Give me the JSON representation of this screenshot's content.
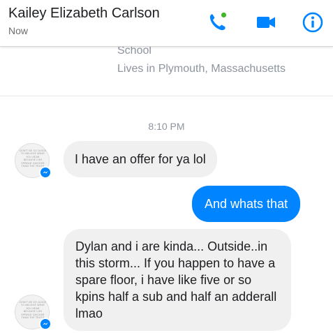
{
  "header": {
    "contact_name": "Kailey Elizabeth Carlson",
    "status": "Now",
    "icons": [
      "phone-icon",
      "video-camera-icon",
      "info-icon"
    ],
    "accent_color": "#0084ff",
    "online_dot_color": "#42b72a"
  },
  "profile": {
    "school": "School",
    "location": "Lives in Plymouth, Massachusetts"
  },
  "thread": {
    "timestamp": "8:10 PM",
    "avatar_caption": "DON'T BE SO QUICK TO BELIEVE WHAT YOU HEAR BECAUSE LIES SPREAD QUICKER THAN THE TRUTH",
    "messages": [
      {
        "sender": "contact",
        "text": "I have an offer for ya lol"
      },
      {
        "sender": "me",
        "text": "And whats that"
      },
      {
        "sender": "contact",
        "text": "Dylan and i are kinda... Outside..in this storm... If you happen to have a spare floor, i have like five or so kpins half a sub and half an adderall lmao"
      }
    ]
  }
}
